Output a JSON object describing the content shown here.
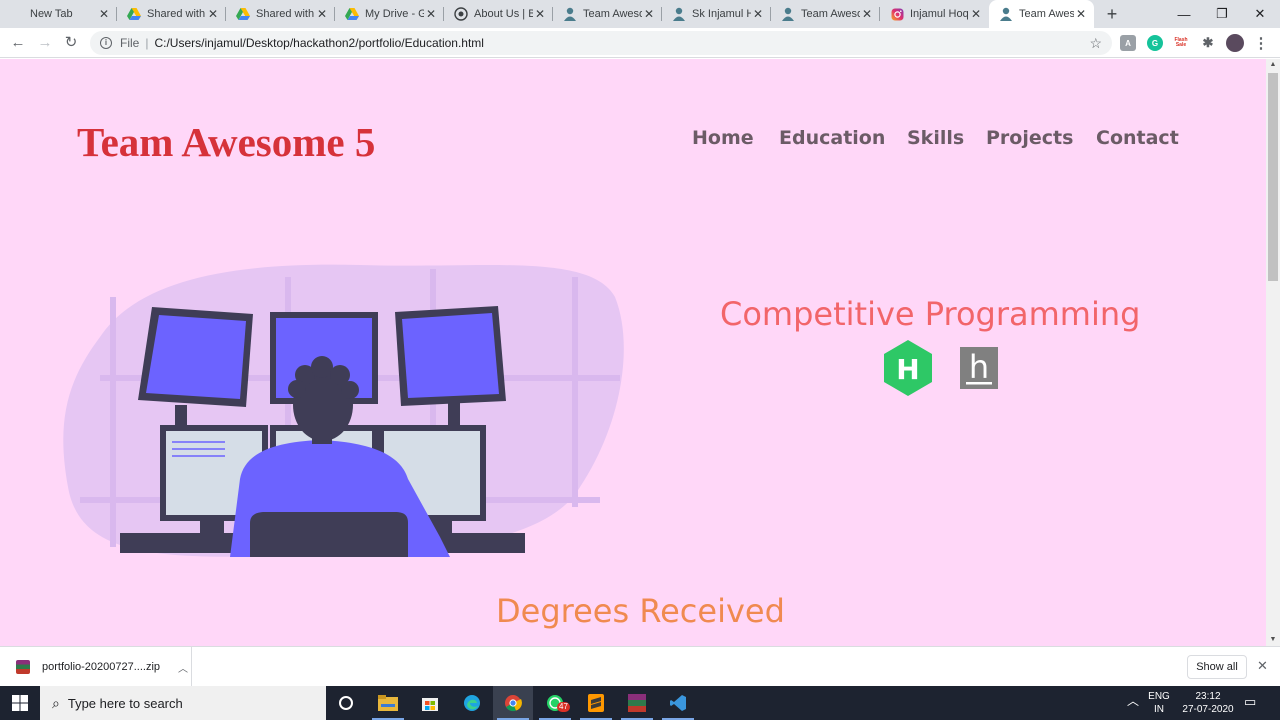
{
  "browser": {
    "tabs": [
      {
        "title": "New Tab",
        "icon": "blank-page-icon"
      },
      {
        "title": "Shared with",
        "icon": "google-drive-icon"
      },
      {
        "title": "Shared with",
        "icon": "google-drive-icon"
      },
      {
        "title": "My Drive - G",
        "icon": "google-drive-icon"
      },
      {
        "title": "About Us | B",
        "icon": "site-seal-icon"
      },
      {
        "title": "Team Aweso",
        "icon": "person-icon"
      },
      {
        "title": "Sk Injamul H",
        "icon": "person-icon"
      },
      {
        "title": "Team Aweso",
        "icon": "person-icon"
      },
      {
        "title": "Injamul Hoq",
        "icon": "instagram-icon"
      },
      {
        "title": "Team Aweso",
        "icon": "person-icon",
        "active": true
      }
    ],
    "new_tab": "+",
    "window_controls": {
      "minimize": "—",
      "maximize": "❐",
      "close": "✕"
    },
    "address": {
      "scheme": "File",
      "url": "C:/Users/injamul/Desktop/hackathon2/portfolio/Education.html"
    },
    "extensions": [
      {
        "name": "pdf-extension-icon",
        "label": "A"
      },
      {
        "name": "grammarly-icon",
        "label": "G"
      },
      {
        "name": "flash-sale-icon",
        "label": "Flash Sale"
      },
      {
        "name": "extensions-puzzle-icon",
        "label": "✱"
      },
      {
        "name": "profile-avatar",
        "label": ""
      },
      {
        "name": "menu-kebab-icon",
        "label": "⋮"
      }
    ]
  },
  "site": {
    "logo": "Team Awesome 5",
    "nav": [
      "Home",
      "Education",
      "Skills",
      "Projects",
      "Contact"
    ],
    "section_title": "Competitive Programming",
    "platform_icons": [
      {
        "name": "hackerrank-icon",
        "label": "H",
        "color": "#2ec866"
      },
      {
        "name": "hackerearth-icon",
        "label": "h",
        "color": "#808080"
      }
    ],
    "degrees_title": "Degrees Received",
    "colors": {
      "background": "#ffd7f8",
      "logo": "#d6323a",
      "nav": "#6b5b66",
      "section_title": "#f2656a",
      "degrees_title": "#f08a50",
      "illustration_accent": "#6c63ff"
    }
  },
  "downloads": {
    "file": "portfolio-20200727....zip",
    "show_all": "Show all",
    "close": "✕"
  },
  "taskbar": {
    "search_placeholder": "Type here to search",
    "apps": [
      "cortana-icon",
      "file-explorer-icon",
      "store-icon",
      "edge-icon",
      "chrome-icon",
      "whatsapp-icon",
      "sublime-text-icon",
      "winrar-icon",
      "vscode-icon"
    ],
    "whatsapp_badge": "47",
    "language": "ENG",
    "region": "IN",
    "time": "23:12",
    "date": "27-07-2020"
  }
}
